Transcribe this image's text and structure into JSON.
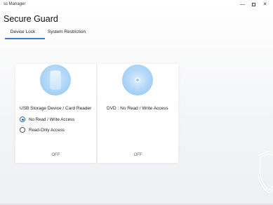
{
  "window": {
    "title": "ss Manager",
    "controls": {
      "minimize": "—",
      "close": "✕"
    }
  },
  "app": {
    "title": "Secure Guard"
  },
  "tabs": [
    {
      "label": "Device Lock",
      "active": true
    },
    {
      "label": "System Restriction",
      "active": false
    }
  ],
  "cards": {
    "usb": {
      "icon": "usb-storage-icon",
      "heading": "USB Storage Device / Card Reader",
      "options": [
        {
          "label": "No Read / Write Access",
          "selected": true
        },
        {
          "label": "Read-Only Access",
          "selected": false
        }
      ],
      "status": "OFF"
    },
    "dvd": {
      "icon": "dvd-disc-icon",
      "heading": "DVD : No Read / Write Access",
      "status": "OFF"
    }
  },
  "colors": {
    "accent": "#3b79d6",
    "icon_circle": "#a9d3f6"
  }
}
